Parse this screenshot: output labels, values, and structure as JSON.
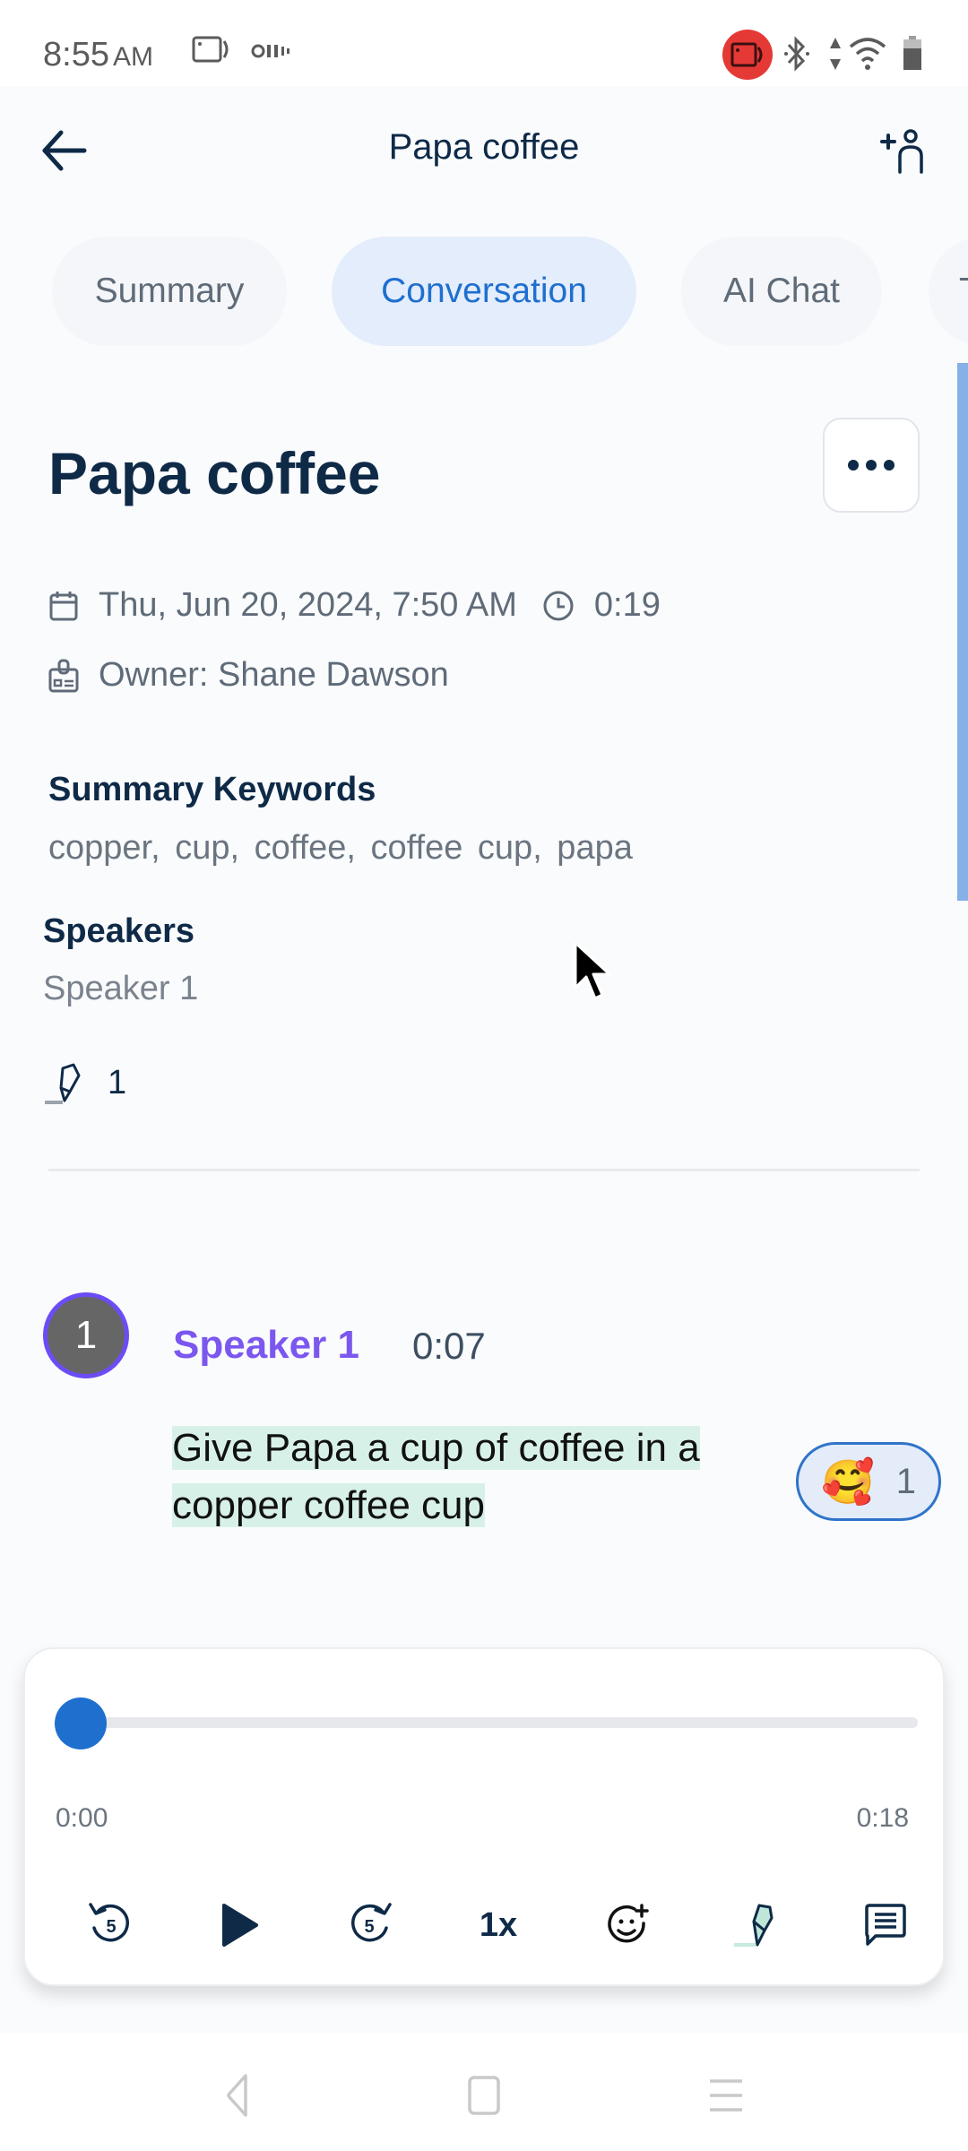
{
  "status_bar": {
    "time": "8:55",
    "ampm": "AM",
    "icons": [
      "screen-record-icon",
      "data-saver-icon",
      "recording-active-icon",
      "bluetooth-icon",
      "data-arrows-icon",
      "wifi-icon",
      "battery-icon"
    ]
  },
  "header": {
    "title": "Papa coffee",
    "back_icon": "arrow-left-icon",
    "add_user_icon": "add-person-icon"
  },
  "tabs": [
    {
      "label": "Summary",
      "active": false
    },
    {
      "label": "Conversation",
      "active": true
    },
    {
      "label": "AI Chat",
      "active": false
    },
    {
      "label": "T",
      "active": false
    }
  ],
  "recording": {
    "title": "Papa coffee",
    "more_icon": "ellipsis-icon",
    "date": "Thu, Jun 20, 2024, 7:50 AM",
    "duration": "0:19",
    "owner": "Owner: Shane Dawson"
  },
  "summary_keywords": {
    "label": "Summary Keywords",
    "keywords": "copper,  cup,  coffee,  coffee cup,  papa"
  },
  "speakers": {
    "label": "Speakers",
    "list": "Speaker 1"
  },
  "highlights": {
    "count": "1"
  },
  "transcript": [
    {
      "avatar_text": "1",
      "speaker": "Speaker 1",
      "timestamp": "0:07",
      "text": "Give Papa a cup of coffee in a copper coffee cup",
      "reaction": {
        "emoji": "🥰",
        "count": "1"
      }
    }
  ],
  "player": {
    "current_time": "0:00",
    "total_time": "0:18",
    "progress": 0.0,
    "speed_label": "1x",
    "controls": [
      "rewind-5-icon",
      "play-icon",
      "forward-5-icon",
      "speed-button",
      "add-reaction-icon",
      "highlighter-icon",
      "comment-icon"
    ]
  },
  "colors": {
    "accent_blue": "#1f6fcf",
    "speaker_purple": "#7b57f0",
    "highlight_green": "#d8f1e8",
    "navy_text": "#0e2a47",
    "recording_red": "#e53935"
  }
}
